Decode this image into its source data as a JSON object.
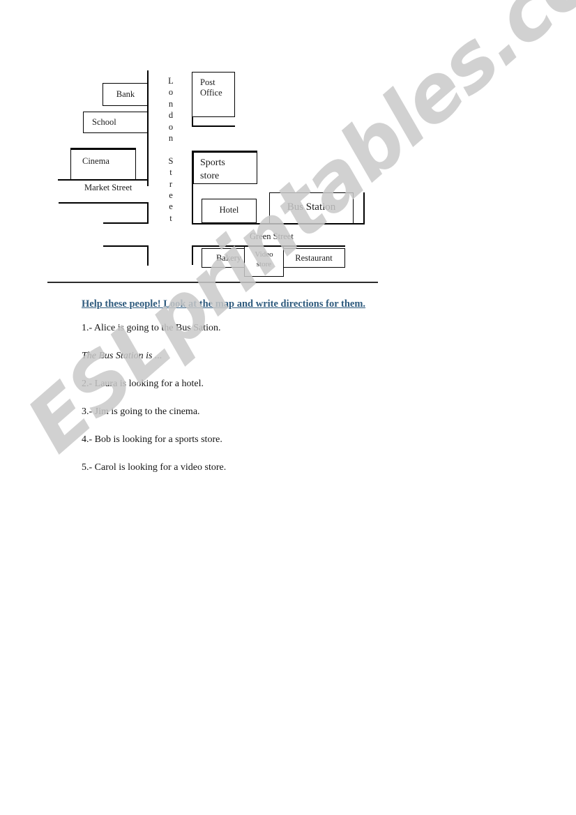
{
  "map": {
    "title": "city-map",
    "vertical_street": {
      "name": "London Street",
      "letters": "L\no\nn\nd\no\nn\n \nS\nt\nr\ne\ne\nt"
    },
    "streets": [
      {
        "name": "Market Street"
      },
      {
        "name": "Green Street"
      }
    ],
    "buildings": [
      {
        "name": "Bank"
      },
      {
        "name": "School"
      },
      {
        "name": "Cinema"
      },
      {
        "name": "Post\nOffice"
      },
      {
        "name": "Sports\nstore"
      },
      {
        "name": "Hotel"
      },
      {
        "name": "Bus Station"
      },
      {
        "name": "Bakery"
      },
      {
        "name": "Video\nstore"
      },
      {
        "name": "Restaurant"
      }
    ]
  },
  "exercise": {
    "heading": "Help these people! Look at the map and write directions for them.",
    "heading_color": "#2e5a7d",
    "items": [
      {
        "text": "1.- Alice is going to the Bus Sation."
      },
      {
        "text": "2.- Laura is looking for a hotel."
      },
      {
        "text": "3.- Jim is going to the cinema."
      },
      {
        "text": "4.- Bob is looking for a sports store."
      },
      {
        "text": "5.- Carol is looking for a video store."
      }
    ],
    "model_answer": "The Bus Station is ..."
  },
  "watermark": {
    "text": "ESLprintables.com",
    "color": "#c9c9c9"
  }
}
